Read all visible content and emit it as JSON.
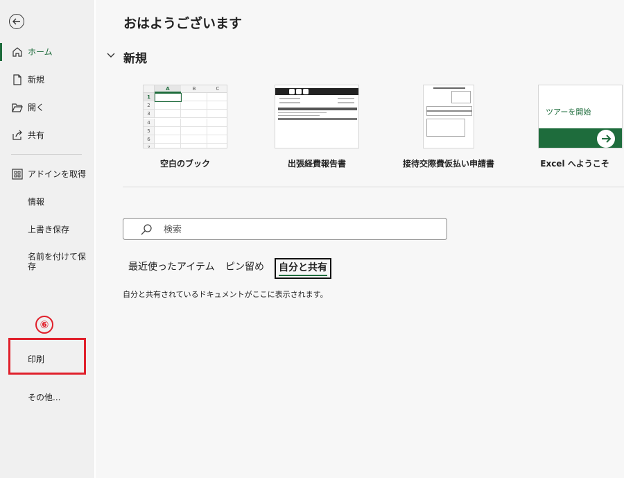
{
  "sidebar": {
    "items": [
      {
        "label": "ホーム"
      },
      {
        "label": "新規"
      },
      {
        "label": "開く"
      },
      {
        "label": "共有"
      },
      {
        "label": "アドインを取得"
      }
    ],
    "text_items": [
      "情報",
      "上書き保存",
      "名前を付けて保存",
      "印刷",
      "その他..."
    ]
  },
  "annotation": {
    "number": "⑥",
    "color": "#e0202b"
  },
  "main": {
    "greeting": "おはようございます",
    "section_title": "新規",
    "templates": [
      {
        "label": "空白のブック"
      },
      {
        "label": "出張経費報告書"
      },
      {
        "label": "接待交際費仮払い申請書"
      },
      {
        "label": "Excel へようこそ",
        "thumb_text": "ツアーを開始"
      }
    ],
    "spreadsheet": {
      "columns": [
        "A",
        "B",
        "C"
      ],
      "rows": [
        "1",
        "2",
        "3",
        "4",
        "5",
        "6",
        "7"
      ]
    },
    "search": {
      "placeholder": "検索"
    },
    "tabs": [
      {
        "label": "最近使ったアイテム"
      },
      {
        "label": "ピン留め"
      },
      {
        "label": "自分と共有"
      }
    ],
    "empty_message": "自分と共有されているドキュメントがここに表示されます。"
  },
  "colors": {
    "accent": "#1e6c3c",
    "annotation": "#e0202b"
  }
}
